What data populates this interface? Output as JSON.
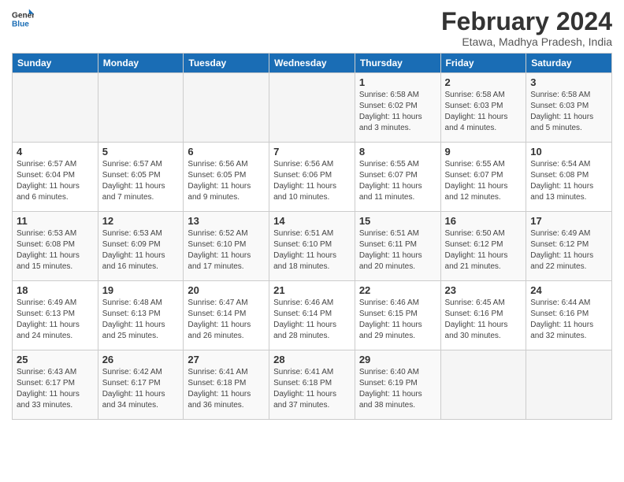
{
  "header": {
    "logo_general": "General",
    "logo_blue": "Blue",
    "month_year": "February 2024",
    "location": "Etawa, Madhya Pradesh, India"
  },
  "weekdays": [
    "Sunday",
    "Monday",
    "Tuesday",
    "Wednesday",
    "Thursday",
    "Friday",
    "Saturday"
  ],
  "weeks": [
    [
      {
        "day": "",
        "info": ""
      },
      {
        "day": "",
        "info": ""
      },
      {
        "day": "",
        "info": ""
      },
      {
        "day": "",
        "info": ""
      },
      {
        "day": "1",
        "info": "Sunrise: 6:58 AM\nSunset: 6:02 PM\nDaylight: 11 hours\nand 3 minutes."
      },
      {
        "day": "2",
        "info": "Sunrise: 6:58 AM\nSunset: 6:03 PM\nDaylight: 11 hours\nand 4 minutes."
      },
      {
        "day": "3",
        "info": "Sunrise: 6:58 AM\nSunset: 6:03 PM\nDaylight: 11 hours\nand 5 minutes."
      }
    ],
    [
      {
        "day": "4",
        "info": "Sunrise: 6:57 AM\nSunset: 6:04 PM\nDaylight: 11 hours\nand 6 minutes."
      },
      {
        "day": "5",
        "info": "Sunrise: 6:57 AM\nSunset: 6:05 PM\nDaylight: 11 hours\nand 7 minutes."
      },
      {
        "day": "6",
        "info": "Sunrise: 6:56 AM\nSunset: 6:05 PM\nDaylight: 11 hours\nand 9 minutes."
      },
      {
        "day": "7",
        "info": "Sunrise: 6:56 AM\nSunset: 6:06 PM\nDaylight: 11 hours\nand 10 minutes."
      },
      {
        "day": "8",
        "info": "Sunrise: 6:55 AM\nSunset: 6:07 PM\nDaylight: 11 hours\nand 11 minutes."
      },
      {
        "day": "9",
        "info": "Sunrise: 6:55 AM\nSunset: 6:07 PM\nDaylight: 11 hours\nand 12 minutes."
      },
      {
        "day": "10",
        "info": "Sunrise: 6:54 AM\nSunset: 6:08 PM\nDaylight: 11 hours\nand 13 minutes."
      }
    ],
    [
      {
        "day": "11",
        "info": "Sunrise: 6:53 AM\nSunset: 6:08 PM\nDaylight: 11 hours\nand 15 minutes."
      },
      {
        "day": "12",
        "info": "Sunrise: 6:53 AM\nSunset: 6:09 PM\nDaylight: 11 hours\nand 16 minutes."
      },
      {
        "day": "13",
        "info": "Sunrise: 6:52 AM\nSunset: 6:10 PM\nDaylight: 11 hours\nand 17 minutes."
      },
      {
        "day": "14",
        "info": "Sunrise: 6:51 AM\nSunset: 6:10 PM\nDaylight: 11 hours\nand 18 minutes."
      },
      {
        "day": "15",
        "info": "Sunrise: 6:51 AM\nSunset: 6:11 PM\nDaylight: 11 hours\nand 20 minutes."
      },
      {
        "day": "16",
        "info": "Sunrise: 6:50 AM\nSunset: 6:12 PM\nDaylight: 11 hours\nand 21 minutes."
      },
      {
        "day": "17",
        "info": "Sunrise: 6:49 AM\nSunset: 6:12 PM\nDaylight: 11 hours\nand 22 minutes."
      }
    ],
    [
      {
        "day": "18",
        "info": "Sunrise: 6:49 AM\nSunset: 6:13 PM\nDaylight: 11 hours\nand 24 minutes."
      },
      {
        "day": "19",
        "info": "Sunrise: 6:48 AM\nSunset: 6:13 PM\nDaylight: 11 hours\nand 25 minutes."
      },
      {
        "day": "20",
        "info": "Sunrise: 6:47 AM\nSunset: 6:14 PM\nDaylight: 11 hours\nand 26 minutes."
      },
      {
        "day": "21",
        "info": "Sunrise: 6:46 AM\nSunset: 6:14 PM\nDaylight: 11 hours\nand 28 minutes."
      },
      {
        "day": "22",
        "info": "Sunrise: 6:46 AM\nSunset: 6:15 PM\nDaylight: 11 hours\nand 29 minutes."
      },
      {
        "day": "23",
        "info": "Sunrise: 6:45 AM\nSunset: 6:16 PM\nDaylight: 11 hours\nand 30 minutes."
      },
      {
        "day": "24",
        "info": "Sunrise: 6:44 AM\nSunset: 6:16 PM\nDaylight: 11 hours\nand 32 minutes."
      }
    ],
    [
      {
        "day": "25",
        "info": "Sunrise: 6:43 AM\nSunset: 6:17 PM\nDaylight: 11 hours\nand 33 minutes."
      },
      {
        "day": "26",
        "info": "Sunrise: 6:42 AM\nSunset: 6:17 PM\nDaylight: 11 hours\nand 34 minutes."
      },
      {
        "day": "27",
        "info": "Sunrise: 6:41 AM\nSunset: 6:18 PM\nDaylight: 11 hours\nand 36 minutes."
      },
      {
        "day": "28",
        "info": "Sunrise: 6:41 AM\nSunset: 6:18 PM\nDaylight: 11 hours\nand 37 minutes."
      },
      {
        "day": "29",
        "info": "Sunrise: 6:40 AM\nSunset: 6:19 PM\nDaylight: 11 hours\nand 38 minutes."
      },
      {
        "day": "",
        "info": ""
      },
      {
        "day": "",
        "info": ""
      }
    ]
  ]
}
